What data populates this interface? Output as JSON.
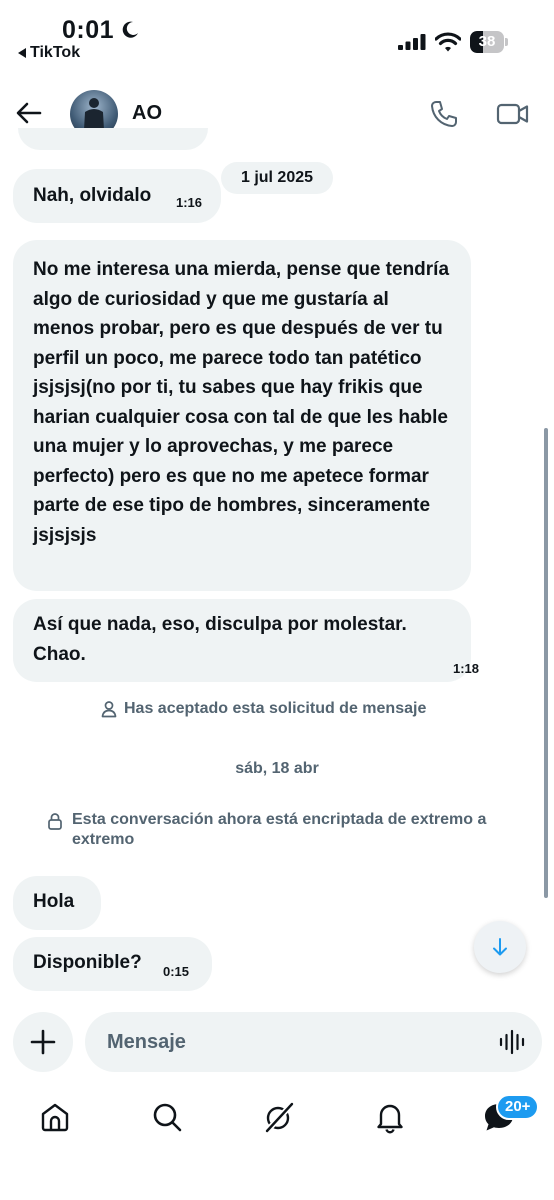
{
  "status_bar": {
    "time": "0:01",
    "back_app": "TikTok",
    "battery_level": "38",
    "battery_fraction": 0.38
  },
  "header": {
    "contact_name": "AO"
  },
  "messages": [
    {
      "date_chip": "1 jul 2025"
    },
    {
      "text": "Nah, olvidalo",
      "time": "1:16"
    },
    {
      "text": "No me interesa una mierda, pense que tendría algo de curiosidad y que me gustaría al menos probar, pero es que después de ver tu perfil un poco, me parece todo tan patético jsjsjsj(no por ti, tu sabes que hay frikis que harian cualquier cosa con tal de que les hable una mujer y lo aprovechas, y me parece perfecto) pero es que no me apetece formar parte de ese tipo de hombres, sinceramente jsjsjsjs"
    },
    {
      "text": "Así que nada, eso, disculpa por molestar. Chao.",
      "time": "1:18"
    },
    {
      "text": "Hola"
    },
    {
      "text": "Disponible?",
      "time": "0:15"
    }
  ],
  "system": {
    "accepted": "Has aceptado esta solicitud de mensaje",
    "date": "sáb, 18 abr",
    "encrypted": "Esta conversación ahora está encriptada de extremo a extremo"
  },
  "composer": {
    "placeholder": "Mensaje"
  },
  "tabbar": {
    "messages_badge": "20+"
  },
  "colors": {
    "accent": "#1d9bf0",
    "bubble": "#eff3f4",
    "muted": "#536471"
  }
}
